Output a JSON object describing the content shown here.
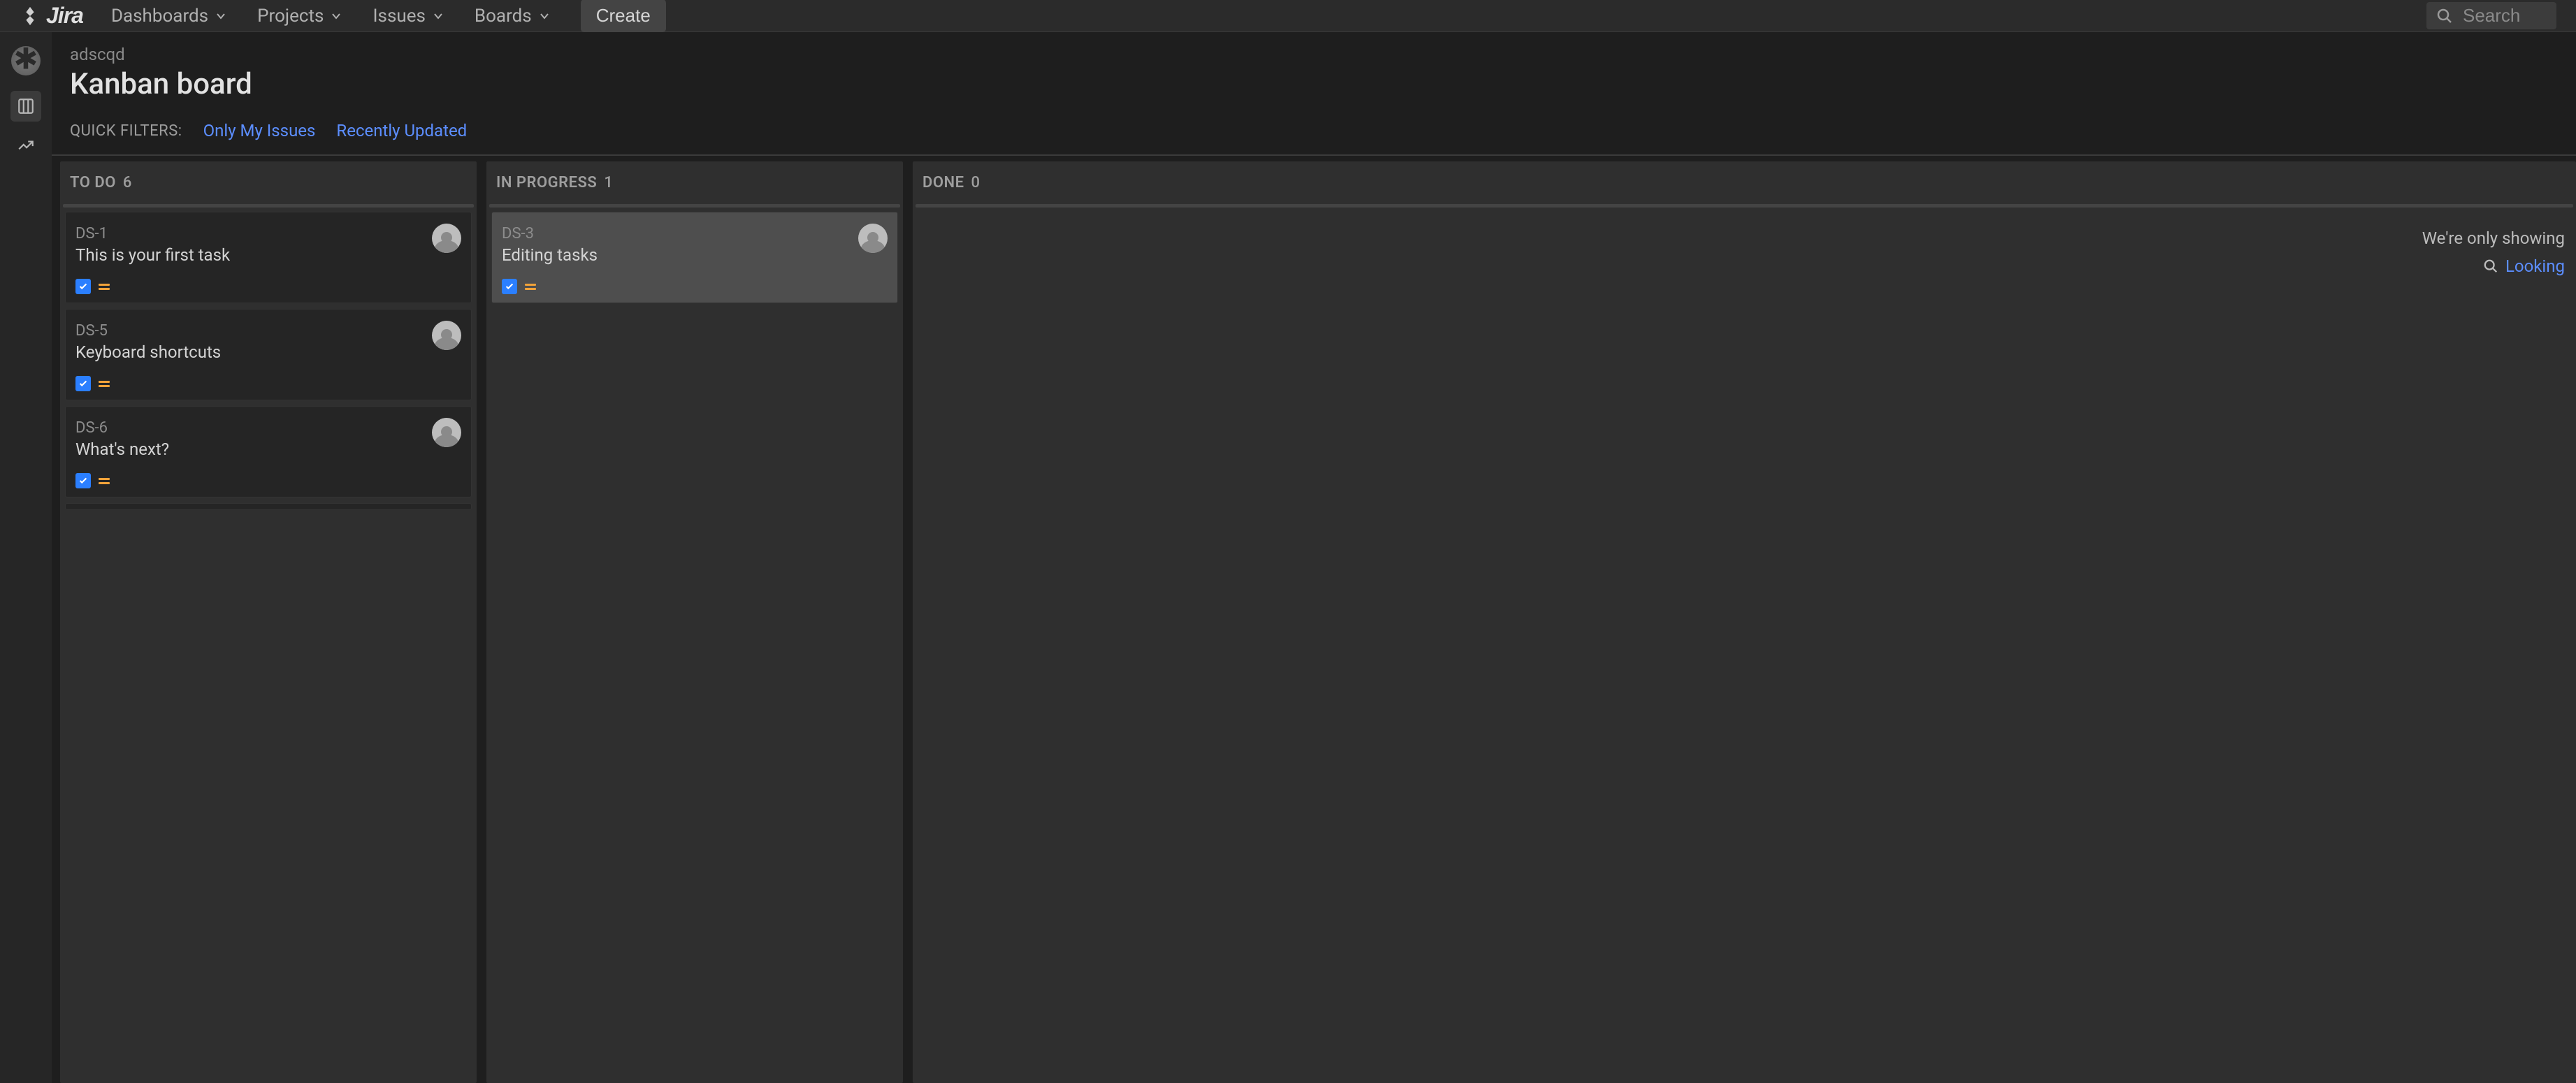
{
  "brand": {
    "name": "Jira"
  },
  "nav": {
    "items": [
      {
        "label": "Dashboards"
      },
      {
        "label": "Projects"
      },
      {
        "label": "Issues"
      },
      {
        "label": "Boards"
      }
    ],
    "create_label": "Create"
  },
  "search": {
    "placeholder": "Search"
  },
  "breadcrumb": "adscqd",
  "page": {
    "title": "Kanban board"
  },
  "filters": {
    "label": "QUICK FILTERS:",
    "links": [
      {
        "label": "Only My Issues"
      },
      {
        "label": "Recently Updated"
      }
    ]
  },
  "columns": [
    {
      "title": "TO DO",
      "count": "6",
      "cards": [
        {
          "key": "DS-1",
          "summary": "This is your first task",
          "selected": false
        },
        {
          "key": "DS-5",
          "summary": "Keyboard shortcuts",
          "selected": false
        },
        {
          "key": "DS-6",
          "summary": "What's next?",
          "selected": false
        }
      ]
    },
    {
      "title": "IN PROGRESS",
      "count": "1",
      "cards": [
        {
          "key": "DS-3",
          "summary": "Editing tasks",
          "selected": true
        }
      ]
    },
    {
      "title": "DONE",
      "count": "0",
      "cards": [],
      "empty_msg": "We're only showing",
      "link": "Looking"
    }
  ],
  "colors": {
    "accent": "#5c8eff",
    "task_icon": "#2b7fff",
    "priority": "#f2a33a"
  }
}
